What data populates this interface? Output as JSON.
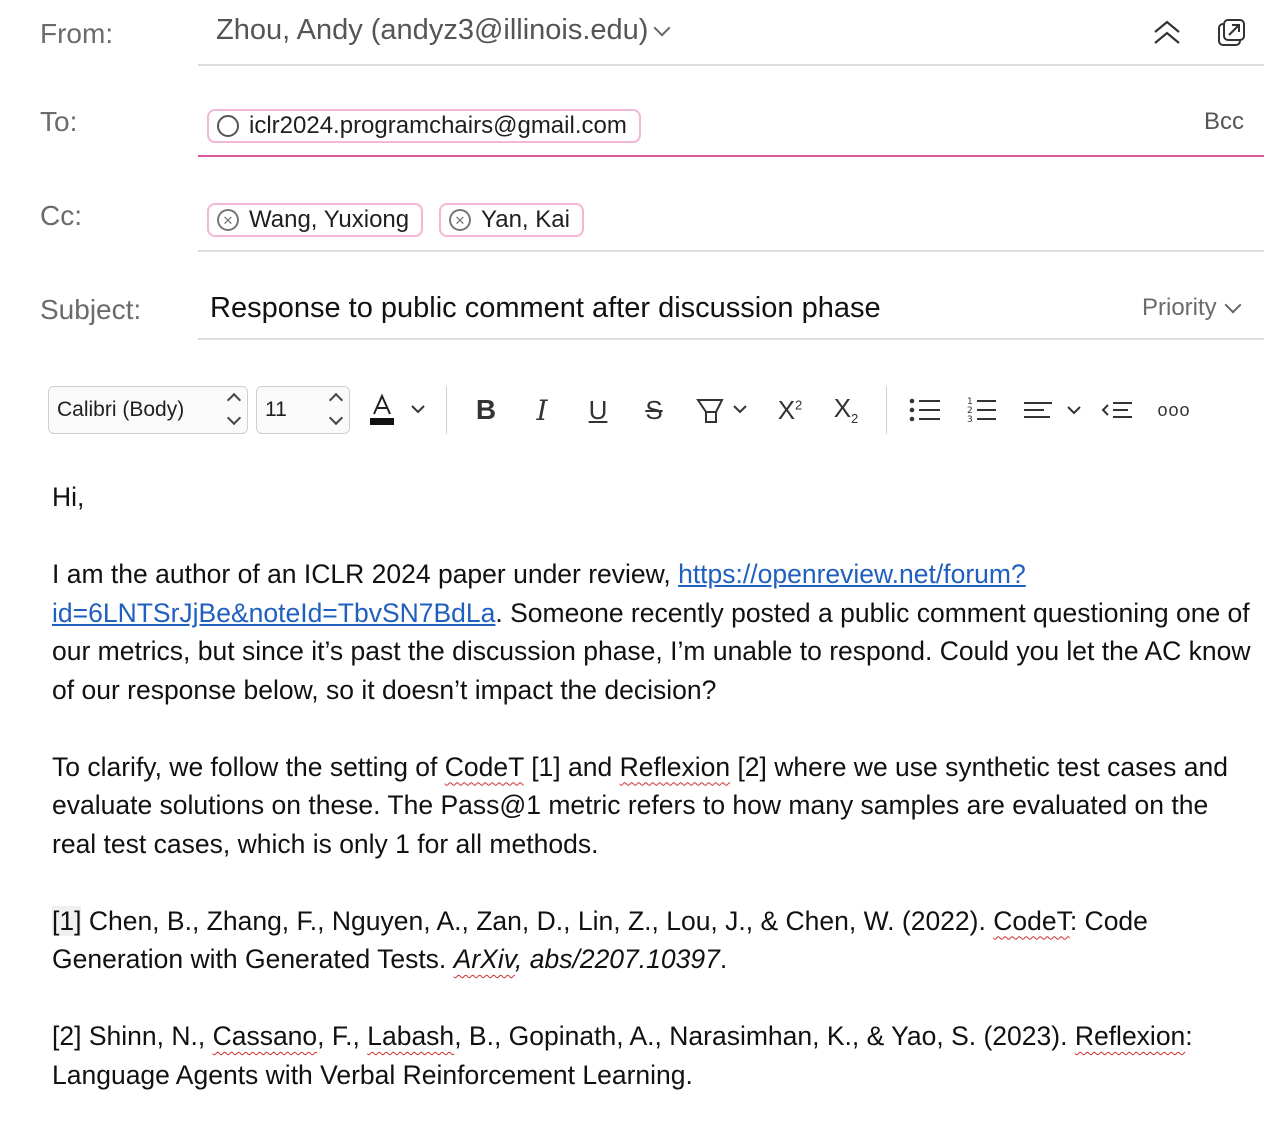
{
  "header": {
    "from_label": "From:",
    "from_value": "Zhou, Andy (andyz3@illinois.edu)",
    "to_label": "To:",
    "to_recipients": [
      {
        "name": "iclr2024.programchairs@gmail.com"
      }
    ],
    "bcc_label": "Bcc",
    "cc_label": "Cc:",
    "cc_recipients": [
      {
        "name": "Wang, Yuxiong"
      },
      {
        "name": "Yan, Kai"
      }
    ],
    "subject_label": "Subject:",
    "subject_value": "Response to public comment after discussion phase",
    "priority_label": "Priority"
  },
  "toolbar": {
    "font_name": "Calibri (Body)",
    "font_size": "11",
    "bold": "B",
    "italic": "I",
    "underline": "U",
    "strike": "S",
    "superscript": "X",
    "subscript": "X",
    "superscript_mark": "2",
    "subscript_mark": "2",
    "more": "ooo"
  },
  "body": {
    "greeting": "Hi,",
    "p1_a": "I am the author of an ICLR 2024 paper under review, ",
    "p1_link_1": "https://openreview.net/forum?",
    "p1_link_2": "id=6LNTSrJjBe&noteId=TbvSN7BdLa",
    "p1_b": ". Someone recently posted a public comment questioning one of our metrics, but since it’s past the discussion phase, I’m unable to respond. Could you let the AC know of our response below, so it doesn’t impact the decision?",
    "p2_a": "To clarify, we follow the setting of ",
    "p2_codet": "CodeT",
    "p2_b": " [1] and ",
    "p2_reflexion": "Reflexion",
    "p2_c": " [2] where we use synthetic test cases and evaluate solutions on these. The Pass@1 metric refers to how many samples are evaluated on the real test cases, which is only 1 for all methods.",
    "r1_num": "[1]",
    "r1_a": " Chen, B., Zhang, F., Nguyen, A., Zan, D., Lin, Z., Lou, J., & Chen, W. (2022). ",
    "r1_codet": "CodeT",
    "r1_b": ": Code Generation with Generated Tests. ",
    "r1_arxiv": "ArXiv",
    "r1_c": ", abs/2207.10397",
    "r1_d": ".",
    "r2_a": "[2] Shinn, N., ",
    "r2_cassano": "Cassano",
    "r2_b": ", F., ",
    "r2_labash": "Labash",
    "r2_c": ", B., Gopinath, A., Narasimhan, K., & Yao, S. (2023). ",
    "r2_reflexion": "Reflexion",
    "r2_d": ": Language Agents with Verbal Reinforcement Learning."
  }
}
